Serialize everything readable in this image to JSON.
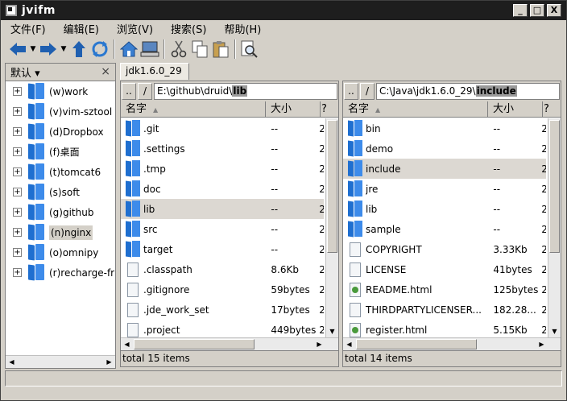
{
  "window": {
    "title": "jvifm",
    "buttons": [
      "_",
      "□",
      "X"
    ]
  },
  "menu": [
    "文件(F)",
    "编辑(E)",
    "浏览(V)",
    "搜索(S)",
    "帮助(H)"
  ],
  "toolbar": {
    "icons": [
      "back-arrow-icon",
      "dropdown-arrow-icon",
      "forward-arrow-icon",
      "dropdown-arrow-icon",
      "up-arrow-icon",
      "refresh-icon",
      "home-icon",
      "computer-icon",
      "cut-icon",
      "copy-icon",
      "paste-icon",
      "search-icon"
    ]
  },
  "sidebar": {
    "title": "默认 ▾",
    "close": "×",
    "items": [
      {
        "label": "(w)work"
      },
      {
        "label": "(v)vim-sztool"
      },
      {
        "label": "(d)Dropbox"
      },
      {
        "label": "(f)桌面"
      },
      {
        "label": "(t)tomcat6"
      },
      {
        "label": "(s)soft"
      },
      {
        "label": "(g)github"
      },
      {
        "label": "(n)nginx",
        "selected": true
      },
      {
        "label": "(o)omnipy"
      },
      {
        "label": "(r)recharge-fr"
      }
    ]
  },
  "tab": {
    "label": "jdk1.6.0_29"
  },
  "left_panel": {
    "path_prefix": "E:\\github\\druid\\",
    "path_highlight": "lib",
    "col_name": "名字",
    "col_size": "大小",
    "col_more": "?",
    "status": "total 15 items",
    "rows": [
      {
        "name": ".git",
        "size": "--",
        "type": "folder"
      },
      {
        "name": ".settings",
        "size": "--",
        "type": "folder"
      },
      {
        "name": ".tmp",
        "size": "--",
        "type": "folder"
      },
      {
        "name": "doc",
        "size": "--",
        "type": "folder"
      },
      {
        "name": "lib",
        "size": "--",
        "type": "folder",
        "selected": true
      },
      {
        "name": "src",
        "size": "--",
        "type": "folder"
      },
      {
        "name": "target",
        "size": "--",
        "type": "folder"
      },
      {
        "name": ".classpath",
        "size": "8.6Kb",
        "type": "file"
      },
      {
        "name": ".gitignore",
        "size": "59bytes",
        "type": "file"
      },
      {
        "name": ".jde_work_set",
        "size": "17bytes",
        "type": "file"
      },
      {
        "name": ".project",
        "size": "449bytes",
        "type": "file"
      }
    ]
  },
  "right_panel": {
    "path_prefix": "C:\\Java\\jdk1.6.0_29\\",
    "path_highlight": "include",
    "col_name": "名字",
    "col_size": "大小",
    "col_more": "?",
    "status": "total 14 items",
    "rows": [
      {
        "name": "bin",
        "size": "--",
        "type": "folder"
      },
      {
        "name": "demo",
        "size": "--",
        "type": "folder"
      },
      {
        "name": "include",
        "size": "--",
        "type": "folder",
        "selected": true
      },
      {
        "name": "jre",
        "size": "--",
        "type": "folder"
      },
      {
        "name": "lib",
        "size": "--",
        "type": "folder"
      },
      {
        "name": "sample",
        "size": "--",
        "type": "folder"
      },
      {
        "name": "COPYRIGHT",
        "size": "3.33Kb",
        "type": "file"
      },
      {
        "name": "LICENSE",
        "size": "41bytes",
        "type": "file"
      },
      {
        "name": "README.html",
        "size": "125bytes",
        "type": "html"
      },
      {
        "name": "THIRDPARTYLICENSER...",
        "size": "182.28...",
        "type": "file"
      },
      {
        "name": "register.html",
        "size": "5.15Kb",
        "type": "html"
      }
    ]
  }
}
